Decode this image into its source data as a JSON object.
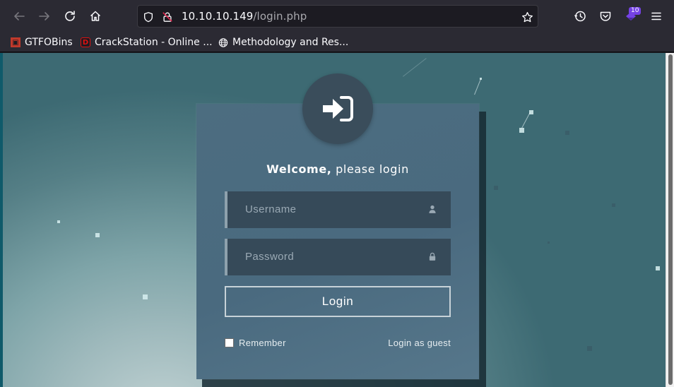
{
  "browser": {
    "url_host": "10.10.10.149",
    "url_path": "/login.php",
    "extension_badge": "10",
    "icons": {
      "back": "arrow-left-icon",
      "forward": "arrow-right-icon",
      "reload": "reload-icon",
      "home": "home-icon",
      "shield": "tracking-shield-icon",
      "lock": "insecure-lock-icon",
      "bookmark": "star-icon",
      "history": "history-icon",
      "pocket": "pocket-icon",
      "extension": "extension-icon",
      "menu": "hamburger-menu-icon"
    }
  },
  "bookmarks": [
    {
      "label": "GTFOBins",
      "icon": "gtfobins-favicon",
      "color": "#c0392b"
    },
    {
      "label": "CrackStation - Online ...",
      "icon": "crackstation-favicon",
      "color": "#cc0000"
    },
    {
      "label": "Methodology and Res...",
      "icon": "globe-icon",
      "color": "#fbfbfe"
    }
  ],
  "login": {
    "welcome_strong": "Welcome,",
    "welcome_rest": " please login",
    "username_placeholder": "Username",
    "password_placeholder": "Password",
    "submit_label": "Login",
    "remember_label": "Remember",
    "guest_link": "Login as guest",
    "icons": {
      "avatar": "sign-in-icon",
      "username": "user-icon",
      "password": "lock-icon"
    }
  },
  "colors": {
    "accent_badge": "#7542e5",
    "card": "#4c6d80",
    "field": "#364a59"
  }
}
